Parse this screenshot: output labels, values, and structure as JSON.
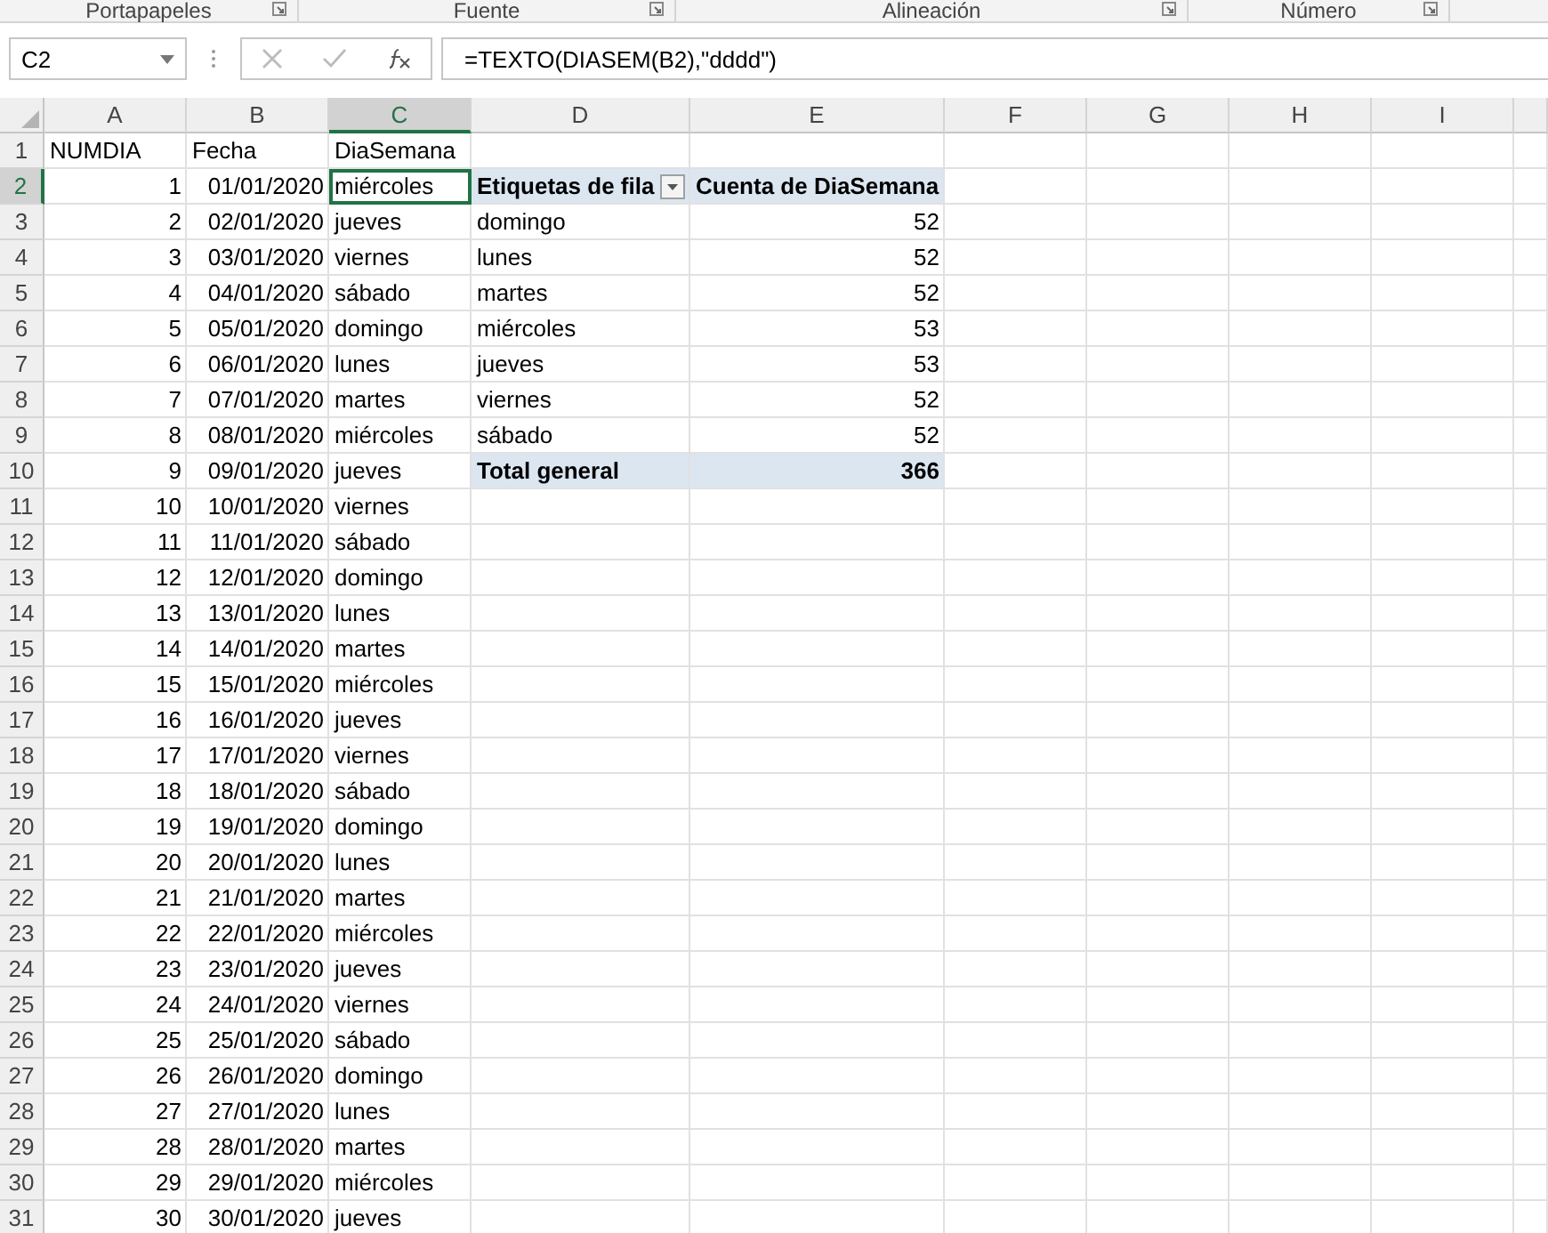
{
  "ribbon_groups": [
    "Portapapeles",
    "Fuente",
    "Alineación",
    "Número"
  ],
  "formula_bar": {
    "name_box": "C2",
    "formula": "=TEXTO(DIASEM(B2),\"dddd\")"
  },
  "columns": [
    {
      "label": "A",
      "selected": false
    },
    {
      "label": "B",
      "selected": false
    },
    {
      "label": "C",
      "selected": true
    },
    {
      "label": "D",
      "selected": false
    },
    {
      "label": "E",
      "selected": false
    },
    {
      "label": "F",
      "selected": false
    },
    {
      "label": "G",
      "selected": false
    },
    {
      "label": "H",
      "selected": false
    },
    {
      "label": "I",
      "selected": false
    }
  ],
  "rows": [
    {
      "header": "1",
      "selected": false,
      "cells": [
        "NUMDIA",
        "Fecha",
        "DiaSemana"
      ]
    },
    {
      "header": "2",
      "selected": true,
      "cells": [
        "1",
        "01/01/2020",
        "miércoles"
      ]
    },
    {
      "header": "3",
      "selected": false,
      "cells": [
        "2",
        "02/01/2020",
        "jueves"
      ]
    },
    {
      "header": "4",
      "selected": false,
      "cells": [
        "3",
        "03/01/2020",
        "viernes"
      ]
    },
    {
      "header": "5",
      "selected": false,
      "cells": [
        "4",
        "04/01/2020",
        "sábado"
      ]
    },
    {
      "header": "6",
      "selected": false,
      "cells": [
        "5",
        "05/01/2020",
        "domingo"
      ]
    },
    {
      "header": "7",
      "selected": false,
      "cells": [
        "6",
        "06/01/2020",
        "lunes"
      ]
    },
    {
      "header": "8",
      "selected": false,
      "cells": [
        "7",
        "07/01/2020",
        "martes"
      ]
    },
    {
      "header": "9",
      "selected": false,
      "cells": [
        "8",
        "08/01/2020",
        "miércoles"
      ]
    },
    {
      "header": "10",
      "selected": false,
      "cells": [
        "9",
        "09/01/2020",
        "jueves"
      ]
    },
    {
      "header": "11",
      "selected": false,
      "cells": [
        "10",
        "10/01/2020",
        "viernes"
      ]
    },
    {
      "header": "12",
      "selected": false,
      "cells": [
        "11",
        "11/01/2020",
        "sábado"
      ]
    },
    {
      "header": "13",
      "selected": false,
      "cells": [
        "12",
        "12/01/2020",
        "domingo"
      ]
    },
    {
      "header": "14",
      "selected": false,
      "cells": [
        "13",
        "13/01/2020",
        "lunes"
      ]
    },
    {
      "header": "15",
      "selected": false,
      "cells": [
        "14",
        "14/01/2020",
        "martes"
      ]
    },
    {
      "header": "16",
      "selected": false,
      "cells": [
        "15",
        "15/01/2020",
        "miércoles"
      ]
    },
    {
      "header": "17",
      "selected": false,
      "cells": [
        "16",
        "16/01/2020",
        "jueves"
      ]
    },
    {
      "header": "18",
      "selected": false,
      "cells": [
        "17",
        "17/01/2020",
        "viernes"
      ]
    },
    {
      "header": "19",
      "selected": false,
      "cells": [
        "18",
        "18/01/2020",
        "sábado"
      ]
    },
    {
      "header": "20",
      "selected": false,
      "cells": [
        "19",
        "19/01/2020",
        "domingo"
      ]
    },
    {
      "header": "21",
      "selected": false,
      "cells": [
        "20",
        "20/01/2020",
        "lunes"
      ]
    },
    {
      "header": "22",
      "selected": false,
      "cells": [
        "21",
        "21/01/2020",
        "martes"
      ]
    },
    {
      "header": "23",
      "selected": false,
      "cells": [
        "22",
        "22/01/2020",
        "miércoles"
      ]
    },
    {
      "header": "24",
      "selected": false,
      "cells": [
        "23",
        "23/01/2020",
        "jueves"
      ]
    },
    {
      "header": "25",
      "selected": false,
      "cells": [
        "24",
        "24/01/2020",
        "viernes"
      ]
    },
    {
      "header": "26",
      "selected": false,
      "cells": [
        "25",
        "25/01/2020",
        "sábado"
      ]
    },
    {
      "header": "27",
      "selected": false,
      "cells": [
        "26",
        "26/01/2020",
        "domingo"
      ]
    },
    {
      "header": "28",
      "selected": false,
      "cells": [
        "27",
        "27/01/2020",
        "lunes"
      ]
    },
    {
      "header": "29",
      "selected": false,
      "cells": [
        "28",
        "28/01/2020",
        "martes"
      ]
    },
    {
      "header": "30",
      "selected": false,
      "cells": [
        "29",
        "29/01/2020",
        "miércoles"
      ]
    },
    {
      "header": "31",
      "selected": false,
      "cells": [
        "30",
        "30/01/2020",
        "jueves"
      ]
    }
  ],
  "pivot": {
    "row_label": "Etiquetas de fila",
    "value_label": "Cuenta de DiaSemana",
    "items": [
      {
        "label": "domingo",
        "count": "52"
      },
      {
        "label": "lunes",
        "count": "52"
      },
      {
        "label": "martes",
        "count": "52"
      },
      {
        "label": "miércoles",
        "count": "53"
      },
      {
        "label": "jueves",
        "count": "53"
      },
      {
        "label": "viernes",
        "count": "52"
      },
      {
        "label": "sábado",
        "count": "52"
      }
    ],
    "total": {
      "label": "Total general",
      "value": "366"
    }
  }
}
